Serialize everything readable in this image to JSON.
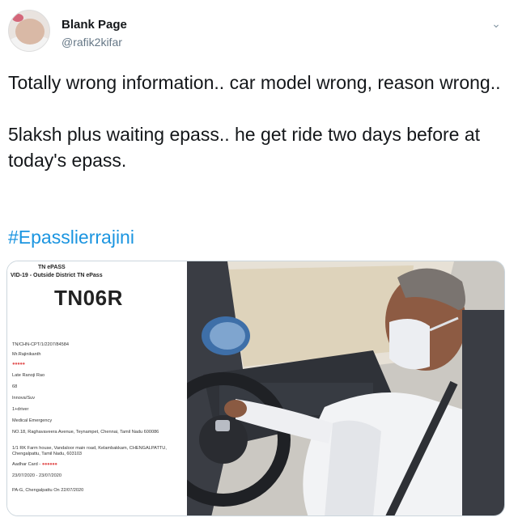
{
  "user": {
    "display_name": "Blank Page",
    "handle": "@rafik2kifar",
    "avatar_icon": "baby-avatar"
  },
  "caret_icon": "chevron-down-icon",
  "tweet": {
    "paragraph1": "Totally wrong information.. car model wrong, reason wrong..",
    "paragraph2": "5laksh plus waiting epass.. he get ride two days before at today's epass.",
    "hashtag": "#Epasslierrajini"
  },
  "epass": {
    "title1": "TN ePASS",
    "title2": "VID-19 - Outside District TN ePass",
    "number": "TN06R",
    "lines": [
      "TN/CHN-CPT/1/2207/84584",
      "Mr.Rajinikanth",
      "Late Ranoji Rao",
      "68",
      "Innova/Suv",
      "1+driver",
      "Medical Emergency",
      "NO.18, Raghavaveera Avenue, Teynampet, Chennai, Tamil Nadu 600086",
      "1/1 RK Farm house, Vandaloor main road, Kelambakkam, CHENGALPATTU, Chengalpattu, Tamil Nadu, 603103",
      "Aadhar Card -",
      "23/07/2020 - 23/07/2020",
      "PA-G, Chengalpattu On 22/07/2020"
    ]
  },
  "colors": {
    "hashtag": "#1b95e0",
    "handle": "#657786",
    "redaction": "#e35a5a"
  }
}
